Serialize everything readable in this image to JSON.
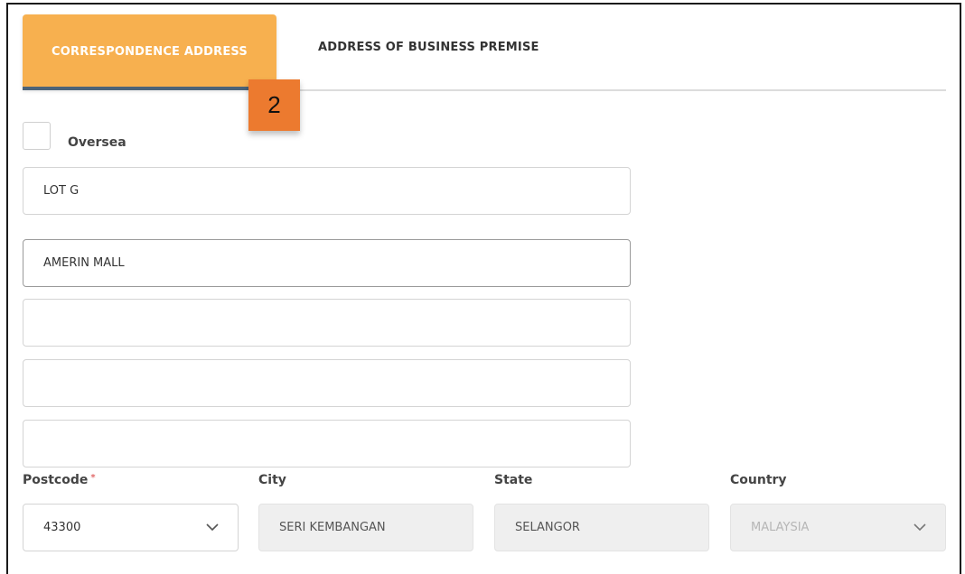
{
  "tabs": [
    {
      "label": "CORRESPONDENCE ADDRESS",
      "active": true
    },
    {
      "label": "ADDRESS OF BUSINESS PREMISE",
      "active": false
    }
  ],
  "step_badge": "2",
  "oversea": {
    "label": "Oversea",
    "checked": false
  },
  "address_lines": [
    "LOT G",
    "AMERIN MALL",
    "",
    "",
    ""
  ],
  "postcode": {
    "label": "Postcode",
    "required_mark": "*",
    "value": "43300"
  },
  "city": {
    "label": "City",
    "value": "SERI KEMBANGAN"
  },
  "state": {
    "label": "State",
    "value": "SELANGOR"
  },
  "country": {
    "label": "Country",
    "value": "MALAYSIA"
  },
  "colors": {
    "tab_active": "#f7b04f",
    "tab_underline": "#4d6378",
    "badge": "#ec7a2f",
    "required": "#e26a6a"
  },
  "icons": {
    "dropdown": "chevron-down-icon"
  }
}
